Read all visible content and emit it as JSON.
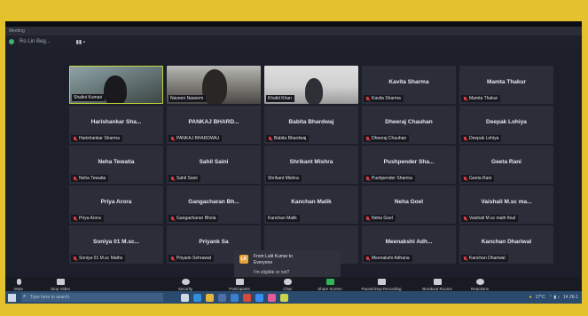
{
  "window": {
    "title": "Meeting",
    "toolbar_title": "Ro Lin Beg..."
  },
  "grid": [
    {
      "kind": "video",
      "style": "v1",
      "label": "Shalini Kumari",
      "big": ""
    },
    {
      "kind": "video",
      "style": "v2",
      "label": "Naveen Naseem",
      "big": ""
    },
    {
      "kind": "video",
      "style": "v3",
      "label": "Khalid Khan",
      "big": ""
    },
    {
      "kind": "name",
      "big": "Kavita Sharma",
      "label": "Kavita Sharma",
      "muted": true
    },
    {
      "kind": "name",
      "big": "Mamta Thakur",
      "label": "Mamta Thakur",
      "muted": true
    },
    {
      "kind": "name",
      "big": "Harishankar Sha...",
      "label": "Harishankar Sharma",
      "muted": true
    },
    {
      "kind": "name",
      "big": "PANKAJ BHARD...",
      "label": "PANKAJ BHARDWAJ",
      "muted": true
    },
    {
      "kind": "name",
      "big": "Babita Bhardwaj",
      "label": "Babita Bhardwaj",
      "muted": true
    },
    {
      "kind": "name",
      "big": "Dheeraj Chauhan",
      "label": "Dheeraj Chauhan",
      "muted": true
    },
    {
      "kind": "name",
      "big": "Deepak Lohiya",
      "label": "Deepak Lohiya",
      "muted": true
    },
    {
      "kind": "name",
      "big": "Neha Tewatia",
      "label": "Neha Tewatia",
      "muted": true
    },
    {
      "kind": "name",
      "big": "Sahil Saini",
      "label": "Sahil Saini",
      "muted": true
    },
    {
      "kind": "name",
      "big": "Shrikant Mishra",
      "label": "Shrikant Mishra",
      "muted": false
    },
    {
      "kind": "name",
      "big": "Pushpender Sha...",
      "label": "Pushpender Sharma",
      "muted": true
    },
    {
      "kind": "name",
      "big": "Geeta Rani",
      "label": "Geeta Rani",
      "muted": true
    },
    {
      "kind": "name",
      "big": "Priya Arora",
      "label": "Priya Arora",
      "muted": true
    },
    {
      "kind": "name",
      "big": "Gangacharan Bh...",
      "label": "Gangacharan Bhola",
      "muted": true
    },
    {
      "kind": "name",
      "big": "Kanchan Malik",
      "label": "Kanchan Malik",
      "muted": false
    },
    {
      "kind": "name",
      "big": "Neha Goel",
      "label": "Neha Goel",
      "muted": true
    },
    {
      "kind": "name",
      "big": "Vaishali M.sc ma...",
      "label": "Vaishali M.sc math final",
      "muted": true
    },
    {
      "kind": "name",
      "big": "Soniya 01 M.sc...",
      "label": "Soniya 01 M.sc Maths",
      "muted": true
    },
    {
      "kind": "name",
      "big": "Priyank Sa",
      "label": "Priyank Sehrawat",
      "muted": true
    },
    {
      "kind": "name",
      "big": "",
      "label": "",
      "muted": false
    },
    {
      "kind": "name",
      "big": "Meenakshi Adh...",
      "label": "Meenakshi Adhana",
      "muted": true
    },
    {
      "kind": "name",
      "big": "Kanchan Dhariwal",
      "label": "Kanchan Dhariwal",
      "muted": true
    }
  ],
  "chat_popup": {
    "initials": "LK",
    "from_line1": "From Lalit Kumar to",
    "from_line2": "Everyone",
    "message": "I'm eligible  or not?"
  },
  "toolbar": {
    "mute": "Mute",
    "stop_video": "Stop Video",
    "security": "Security",
    "participants": "Participants",
    "participants_count": "24",
    "chat": "Chat",
    "share_screen": "Share Screen",
    "record": "Pause/Stop Recording",
    "breakout": "Breakout Rooms",
    "reactions": "Reactions"
  },
  "taskbar": {
    "search_placeholder": "Type here to search",
    "temperature": "17°C",
    "time": "14",
    "date": "26-1"
  },
  "colors": {
    "accent_green": "#33b35a",
    "mute_red": "#e23b3b",
    "tile_bg": "#2b2e38"
  }
}
